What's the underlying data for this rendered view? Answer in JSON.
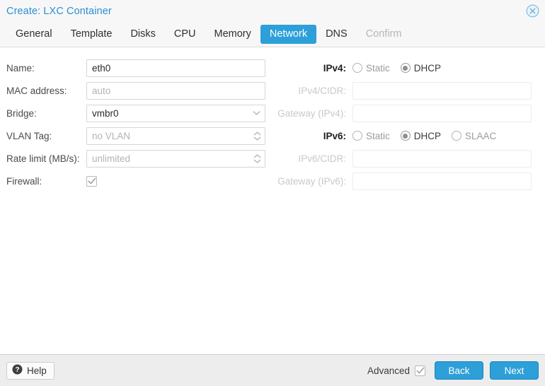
{
  "window": {
    "title": "Create: LXC Container",
    "close_icon": "close-circle-icon"
  },
  "tabs": [
    {
      "label": "General",
      "state": "normal"
    },
    {
      "label": "Template",
      "state": "normal"
    },
    {
      "label": "Disks",
      "state": "normal"
    },
    {
      "label": "CPU",
      "state": "normal"
    },
    {
      "label": "Memory",
      "state": "normal"
    },
    {
      "label": "Network",
      "state": "active"
    },
    {
      "label": "DNS",
      "state": "normal"
    },
    {
      "label": "Confirm",
      "state": "disabled"
    }
  ],
  "form": {
    "left": {
      "name": {
        "label": "Name:",
        "value": "eth0",
        "placeholder": "",
        "is_placeholder": false
      },
      "mac": {
        "label": "MAC address:",
        "value": "auto",
        "placeholder": "auto",
        "is_placeholder": true
      },
      "bridge": {
        "label": "Bridge:",
        "value": "vmbr0",
        "is_placeholder": false,
        "trigger_icon": "chevron-down-icon"
      },
      "vlan": {
        "label": "VLAN Tag:",
        "value": "no VLAN",
        "placeholder": "no VLAN",
        "is_placeholder": true,
        "trigger_icon": "spinner-updown-icon"
      },
      "rate": {
        "label": "Rate limit (MB/s):",
        "value": "unlimited",
        "placeholder": "unlimited",
        "is_placeholder": true,
        "trigger_icon": "spinner-updown-icon"
      },
      "firewall": {
        "label": "Firewall:",
        "checked": true
      }
    },
    "right": {
      "ipv4": {
        "label": "IPv4:",
        "options": [
          {
            "label": "Static",
            "selected": false
          },
          {
            "label": "DHCP",
            "selected": true
          }
        ]
      },
      "ipv4_cidr": {
        "label": "IPv4/CIDR:",
        "value": "",
        "disabled": true
      },
      "ipv4_gateway": {
        "label": "Gateway (IPv4):",
        "value": "",
        "disabled": true
      },
      "ipv6": {
        "label": "IPv6:",
        "options": [
          {
            "label": "Static",
            "selected": false
          },
          {
            "label": "DHCP",
            "selected": true
          },
          {
            "label": "SLAAC",
            "selected": false
          }
        ]
      },
      "ipv6_cidr": {
        "label": "IPv6/CIDR:",
        "value": "",
        "disabled": true
      },
      "ipv6_gateway": {
        "label": "Gateway (IPv6):",
        "value": "",
        "disabled": true
      }
    }
  },
  "footer": {
    "help_label": "Help",
    "help_icon": "question-circle-icon",
    "advanced_label": "Advanced",
    "advanced_checked": true,
    "back_label": "Back",
    "next_label": "Next"
  },
  "colors": {
    "accent": "#2d9fd9",
    "title_text": "#2a8fd0",
    "header_bg": "#f7f7f7",
    "footer_bg": "#ededed",
    "body_bg": "#ffffff",
    "disabled_text": "#c9c9c9"
  }
}
